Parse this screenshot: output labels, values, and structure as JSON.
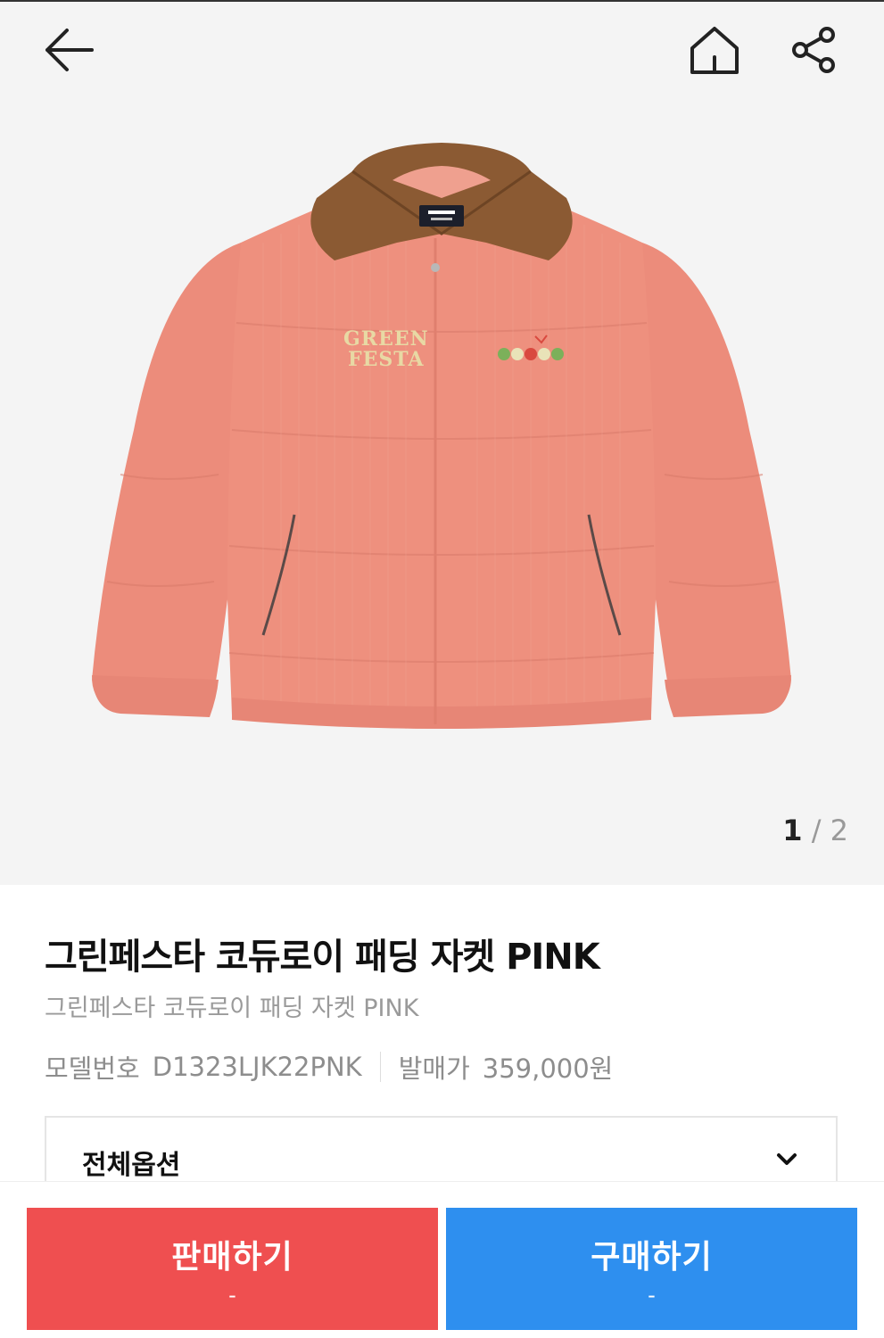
{
  "header": {
    "back_icon": "arrow-left-icon",
    "home_icon": "home-icon",
    "share_icon": "share-icon"
  },
  "gallery": {
    "current": "1",
    "separator": "/",
    "total": "2",
    "jacket_text": "GREEN\nFESTA"
  },
  "product": {
    "title": "그린페스타 코듀로이 패딩 자켓 PINK",
    "subtitle": "그린페스타 코듀로이 패딩 자켓 PINK",
    "model_label": "모델번호",
    "model_value": "D1323LJK22PNK",
    "release_label": "발매가",
    "release_value": "359,000원"
  },
  "options": {
    "label": "전체옵션",
    "icon": "chevron-down-icon"
  },
  "actions": {
    "sell_label": "판매하기",
    "sell_price": "-",
    "buy_label": "구매하기",
    "buy_price": "-",
    "sell_color": "#ef4f50",
    "buy_color": "#2e8fef"
  }
}
